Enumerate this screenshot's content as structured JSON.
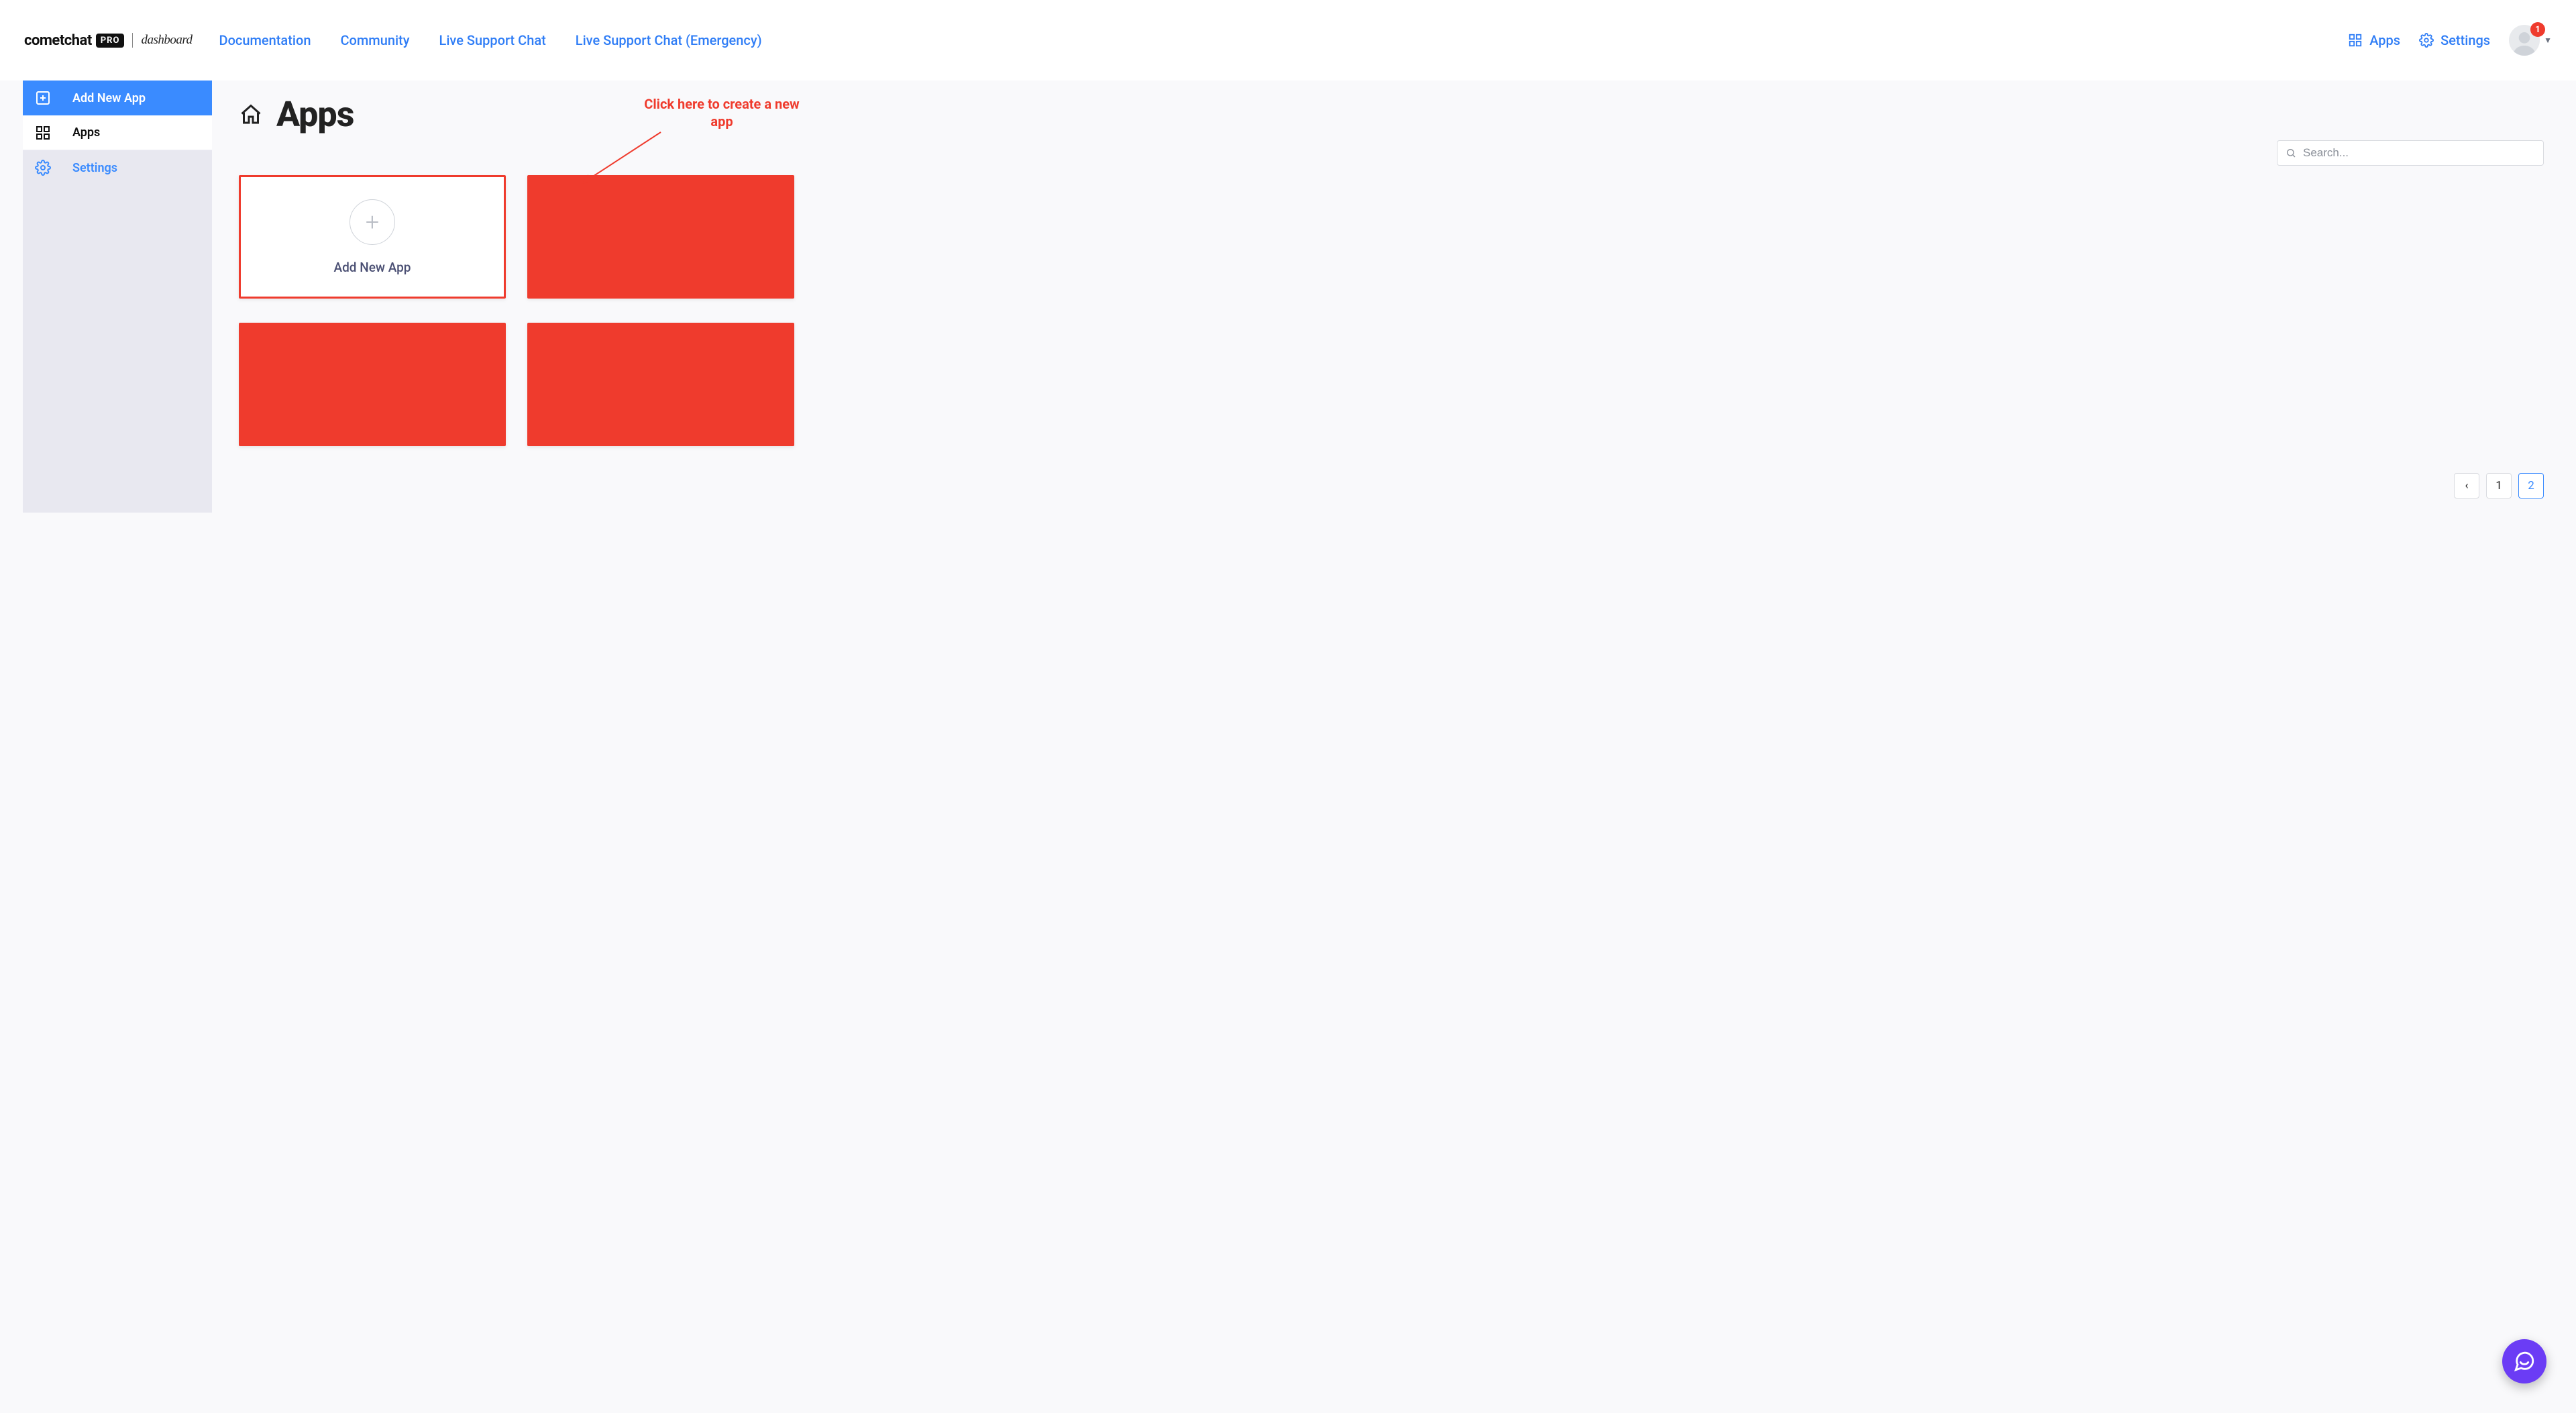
{
  "brand": {
    "name": "cometchat",
    "badge": "PRO",
    "suffix": "dashboard"
  },
  "topnav": {
    "documentation": "Documentation",
    "community": "Community",
    "live_support": "Live Support Chat",
    "live_support_emergency": "Live Support Chat (Emergency)"
  },
  "header_right": {
    "apps": "Apps",
    "settings": "Settings",
    "notif_count": "1"
  },
  "sidebar": {
    "add_new_app": "Add New App",
    "apps": "Apps",
    "settings": "Settings"
  },
  "page": {
    "title": "Apps"
  },
  "annotation": {
    "text": "Click here to create a new app"
  },
  "search": {
    "placeholder": "Search..."
  },
  "add_card": {
    "label": "Add New App"
  },
  "pagination": {
    "prev_glyph": "‹",
    "page1": "1",
    "page2": "2"
  },
  "colors": {
    "accent_blue": "#3a8bff",
    "link_blue": "#2f7df6",
    "annotation_red": "#ef3b2d",
    "fab_purple": "#6b3cf5"
  }
}
